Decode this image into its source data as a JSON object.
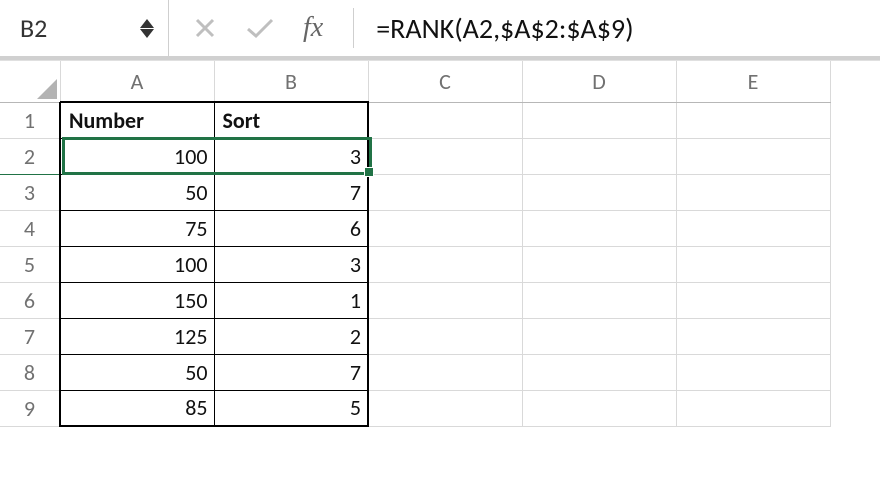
{
  "nameBox": "B2",
  "formula": "=RANK(A2,$A$2:$A$9)",
  "columns": [
    "A",
    "B",
    "C",
    "D",
    "E"
  ],
  "rowNumbers": [
    "1",
    "2",
    "3",
    "4",
    "5",
    "6",
    "7",
    "8",
    "9"
  ],
  "headers": {
    "a": "Number",
    "b": "Sort"
  },
  "rows": [
    {
      "a": "100",
      "b": "3"
    },
    {
      "a": "50",
      "b": "7"
    },
    {
      "a": "75",
      "b": "6"
    },
    {
      "a": "100",
      "b": "3"
    },
    {
      "a": "150",
      "b": "1"
    },
    {
      "a": "125",
      "b": "2"
    },
    {
      "a": "50",
      "b": "7"
    },
    {
      "a": "85",
      "b": "5"
    }
  ],
  "fxLabel": "fx"
}
